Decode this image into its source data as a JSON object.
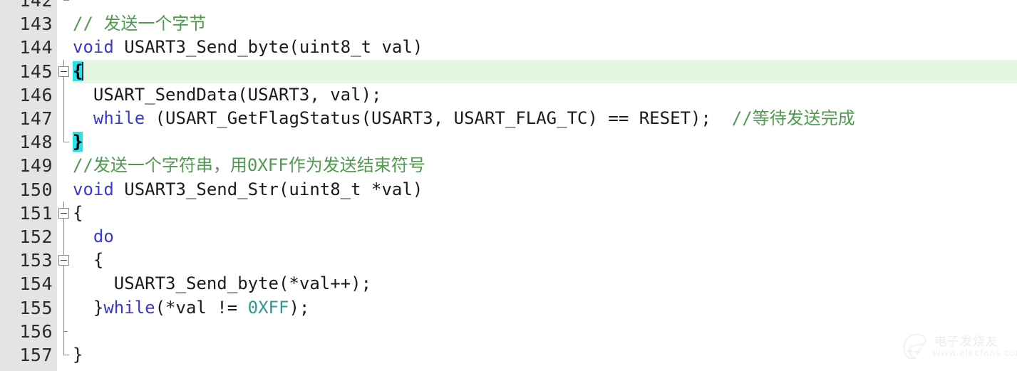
{
  "editor": {
    "name": "code-editor",
    "language": "C",
    "colors": {
      "background": "#ffffff",
      "gutter_background": "#e4e4e4",
      "line_number": "#2b2b2b",
      "current_line_highlight": "#e3f7e3",
      "brace_match_highlight": "#24e2ec",
      "keyword": "#3a39cc",
      "comment": "#4f9a4f",
      "number": "#2c9a9a",
      "plain_text": "#1b1b1b",
      "fold_marker": "#8a8a8a"
    },
    "current_line": 145,
    "lines": [
      {
        "number": "142",
        "fold": "end",
        "partial_top": true,
        "tokens": [
          {
            "t": "",
            "c": "plain"
          }
        ]
      },
      {
        "number": "143",
        "fold": "none",
        "tokens": [
          {
            "t": "// 发送一个字节",
            "c": "cmt"
          }
        ]
      },
      {
        "number": "144",
        "fold": "none",
        "tokens": [
          {
            "t": "void",
            "c": "kw"
          },
          {
            "t": " USART3_Send_byte(uint8_t val)",
            "c": "plain"
          }
        ]
      },
      {
        "number": "145",
        "fold": "box",
        "current": true,
        "tokens": [
          {
            "t": "{",
            "c": "brace-hl"
          },
          {
            "t": "",
            "c": "caret"
          }
        ]
      },
      {
        "number": "146",
        "fold": "line",
        "tokens": [
          {
            "t": "  USART_SendData(USART3, val);",
            "c": "plain"
          }
        ]
      },
      {
        "number": "147",
        "fold": "line",
        "tokens": [
          {
            "t": "  ",
            "c": "plain"
          },
          {
            "t": "while",
            "c": "kw"
          },
          {
            "t": " (USART_GetFlagStatus(USART3, USART_FLAG_TC) == RESET);  ",
            "c": "plain"
          },
          {
            "t": "//等待发送完成",
            "c": "cmt"
          }
        ]
      },
      {
        "number": "148",
        "fold": "end",
        "tokens": [
          {
            "t": "}",
            "c": "brace-hl"
          }
        ]
      },
      {
        "number": "149",
        "fold": "none",
        "tokens": [
          {
            "t": "//发送一个字符串，用0XFF作为发送结束符号",
            "c": "cmt"
          }
        ]
      },
      {
        "number": "150",
        "fold": "none",
        "tokens": [
          {
            "t": "void",
            "c": "kw"
          },
          {
            "t": " USART3_Send_Str(uint8_t *val)",
            "c": "plain"
          }
        ]
      },
      {
        "number": "151",
        "fold": "box",
        "tokens": [
          {
            "t": "{",
            "c": "plain"
          }
        ]
      },
      {
        "number": "152",
        "fold": "line",
        "tokens": [
          {
            "t": "  ",
            "c": "plain"
          },
          {
            "t": "do",
            "c": "kw"
          }
        ]
      },
      {
        "number": "153",
        "fold": "box",
        "tokens": [
          {
            "t": "  {",
            "c": "plain"
          }
        ]
      },
      {
        "number": "154",
        "fold": "line",
        "tokens": [
          {
            "t": "    USART3_Send_byte(*val++);",
            "c": "plain"
          }
        ]
      },
      {
        "number": "155",
        "fold": "line",
        "tokens": [
          {
            "t": "  }",
            "c": "plain"
          },
          {
            "t": "while",
            "c": "kw"
          },
          {
            "t": "(*val != ",
            "c": "plain"
          },
          {
            "t": "0XFF",
            "c": "num"
          },
          {
            "t": ");",
            "c": "plain"
          }
        ]
      },
      {
        "number": "156",
        "fold": "tick",
        "tokens": [
          {
            "t": "",
            "c": "plain"
          }
        ]
      },
      {
        "number": "157",
        "fold": "end",
        "tokens": [
          {
            "t": "}",
            "c": "plain"
          }
        ]
      }
    ]
  },
  "watermark": {
    "brand": "电子发烧友",
    "url": "www.elecfans.com"
  }
}
